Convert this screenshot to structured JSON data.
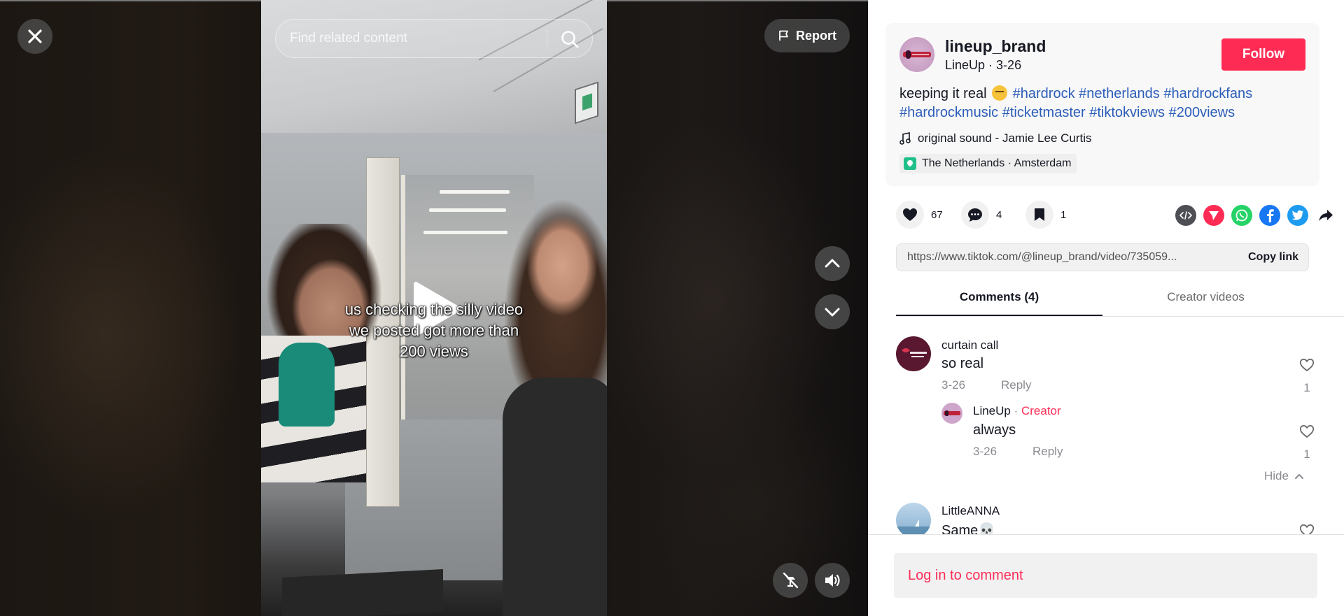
{
  "player": {
    "search_placeholder": "Find related content",
    "report_label": "Report",
    "caption": "us checking the silly video\nwe posted got more than\n200 views"
  },
  "post": {
    "username": "lineup_brand",
    "display_name": "LineUp",
    "date": "3-26",
    "subline_sep": " · ",
    "follow_label": "Follow",
    "description_text": "keeping it real",
    "hashtags": [
      "#hardrock",
      "#netherlands",
      "#hardrockfans",
      "#hardrockmusic",
      "#ticketmaster",
      "#tiktokviews",
      "#200views"
    ],
    "music": "original sound - Jamie  Lee  Curtis",
    "location": "The Netherlands · Amsterdam"
  },
  "stats": {
    "likes": "67",
    "comments": "4",
    "saves": "1"
  },
  "share": {
    "icons": [
      "embed-icon",
      "send-icon",
      "whatsapp-icon",
      "facebook-icon",
      "twitter-icon",
      "share-arrow-icon"
    ],
    "colors": {
      "embed": "#4e4e55",
      "send": "#fe2c55",
      "whatsapp": "#25d366",
      "facebook": "#1877f2",
      "twitter": "#1d9bf0"
    }
  },
  "link": {
    "url": "https://www.tiktok.com/@lineup_brand/video/735059...",
    "copy_label": "Copy link"
  },
  "tabs": {
    "comments": "Comments (4)",
    "creator_videos": "Creator videos"
  },
  "comments": [
    {
      "name": "curtain call",
      "text": "so real",
      "date": "3-26",
      "reply_label": "Reply",
      "likes": "1",
      "replies": [
        {
          "name": "LineUp",
          "creator_sep": " · ",
          "creator_label": "Creator",
          "text": "always",
          "date": "3-26",
          "reply_label": "Reply",
          "likes": "1"
        }
      ],
      "hide_label": "Hide"
    },
    {
      "name": "LittleANNA",
      "text": "Same💀"
    }
  ],
  "comment_bar": {
    "login_label": "Log in to comment"
  },
  "colors": {
    "accent": "#fe2c55",
    "hashtag": "#2b5db9",
    "muted": "#8a8b91"
  }
}
